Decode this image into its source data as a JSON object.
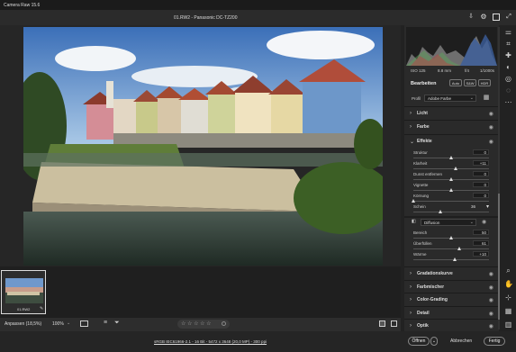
{
  "app_title": "Camera Raw 15.6",
  "file_title": "01.RW2 - Panasonic DC-TZ200",
  "icons": [
    "save-icon",
    "gear-icon",
    "maximize-icon",
    "fullscreen-icon"
  ],
  "histogram": {
    "iso": "ISO 125",
    "focal": "8.8 mm",
    "aperture": "f/4",
    "shutter": "1/1000s"
  },
  "panel": {
    "title": "Bearbeiten",
    "mode_auto": "Auto",
    "mode_bw": "S&W",
    "mode_hdr": "HDR",
    "profile_label": "Profil",
    "profile_value": "Adobe Farbe",
    "sections_top": [
      {
        "label": "Licht"
      },
      {
        "label": "Farbe"
      }
    ],
    "effects": {
      "label": "Effekte",
      "sliders": [
        {
          "label": "Struktur",
          "value": "0",
          "fraction": 0.5
        },
        {
          "label": "Klarheit",
          "value": "+11",
          "fraction": 0.555
        },
        {
          "label": "Dunst entfernen",
          "value": "0",
          "fraction": 0.5
        },
        {
          "label": "Vignette",
          "value": "0",
          "fraction": 0.5
        },
        {
          "label": "Körnung",
          "value": "0",
          "fraction": 0.0
        }
      ],
      "sharpen_label": "Schein",
      "sharpen_value": "36",
      "diffusion_label": "Diffusion",
      "sub_sliders": [
        {
          "label": "Bereich",
          "value": "50",
          "fraction": 0.5
        },
        {
          "label": "Überfüllen",
          "value": "61",
          "fraction": 0.61
        },
        {
          "label": "Wärme",
          "value": "+10",
          "fraction": 0.55
        }
      ]
    },
    "sections_bottom": [
      {
        "label": "Gradationskurve"
      },
      {
        "label": "Farbmischer"
      },
      {
        "label": "Color-Grading"
      },
      {
        "label": "Detail"
      },
      {
        "label": "Optik"
      }
    ]
  },
  "filmstrip": {
    "thumb_label": "01.RW2"
  },
  "bottombar": {
    "zoom_fit": "Anpassen (18,5%)",
    "zoom_pct": "100%",
    "stars": "☆ ☆ ☆ ☆ ☆"
  },
  "footer": {
    "info": "sRGB IEC61966-2.1 - 16 Bit - 5472 x 3648 (20,0 MP) - 300 ppi",
    "open_button": "Öffnen",
    "cancel_button": "Abbrechen",
    "done_button": "Fertig"
  }
}
